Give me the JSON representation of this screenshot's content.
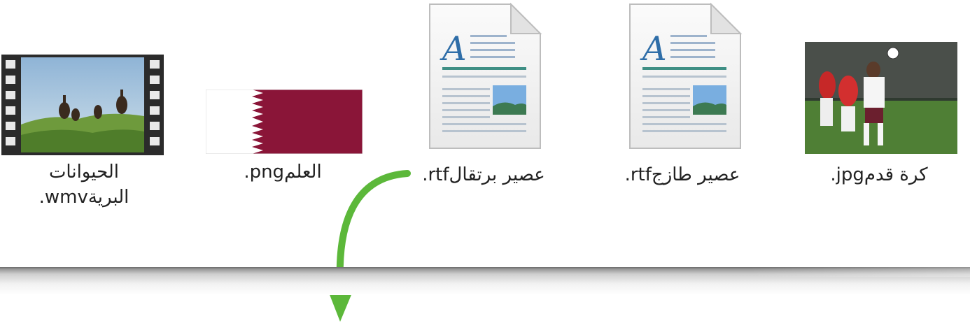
{
  "files": [
    {
      "id": "wmv",
      "label": "الحيوانات\n.wmvالبرية",
      "type": "video-icon"
    },
    {
      "id": "png",
      "label": ".pngالعلم",
      "type": "image-icon"
    },
    {
      "id": "rtf1",
      "label": ".rtfعصير برتقال",
      "type": "document-icon"
    },
    {
      "id": "rtf2",
      "label": ".rtfعصير طازج",
      "type": "document-icon"
    },
    {
      "id": "jpg",
      "label": ".jpgكرة قدم",
      "type": "photo-icon"
    }
  ],
  "colors": {
    "flag_maroon": "#8a1538",
    "arrow_green": "#5cb83a",
    "doc_accent_blue": "#2f6ea8",
    "doc_accent_teal": "#3f8f85"
  }
}
